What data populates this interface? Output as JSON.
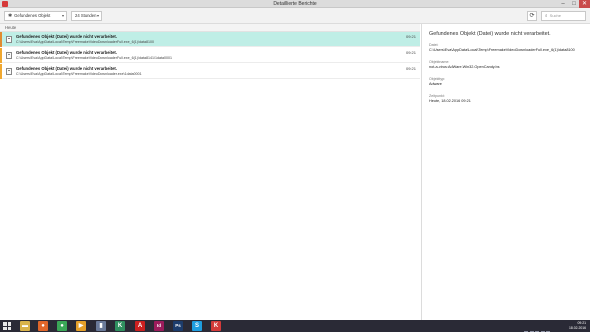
{
  "window": {
    "title": "Detaillierte Berichte"
  },
  "toolbar": {
    "filter_value": "Gefundenes Objekt",
    "time_value": "24 Stunden",
    "search_placeholder": "Suche"
  },
  "list": {
    "group_header": "Heute",
    "items": [
      {
        "title": "Gefundenes Objekt (Datei) wurde nicht verarbeitet.",
        "path": "C:\\Users\\Eva\\AppData\\Local\\Temp\\FreemakeVideoDownloaderFull.exe_6(1)\\data8100",
        "time": "09:21",
        "selected": true
      },
      {
        "title": "Gefundenes Objekt (Datei) wurde nicht verarbeitet.",
        "path": "C:\\Users\\Eva\\AppData\\Local\\Temp\\FreemakeVideoDownloaderFull.exe_6(1)\\data8141\\1data0001",
        "time": "09:21",
        "selected": false
      },
      {
        "title": "Gefundenes Objekt (Datei) wurde nicht verarbeitet.",
        "path": "C:\\Users\\Eva\\AppData\\Local\\Temp\\FreemakeVideoDownloader.exe\\1data0001",
        "time": "09:21",
        "selected": false
      }
    ]
  },
  "detail": {
    "title": "Gefundenes Objekt (Datei) wurde nicht verarbeitet.",
    "fields": [
      {
        "label": "Datei:",
        "value": "C:\\Users\\Eva\\AppData\\Local\\Temp\\FreemakeVideoDownloaderFull.exe_6(1)\\data8100"
      },
      {
        "label": "Objektname:",
        "value": "not-a-virus:AdWare.Win32.OpenCandy.bs"
      },
      {
        "label": "Objekttyp:",
        "value": "Adware"
      },
      {
        "label": "Zeitpunkt:",
        "value": "Heute, 18.02.2016 09:21"
      }
    ]
  },
  "taskbar": {
    "apps": [
      {
        "name": "file-explorer-icon",
        "color": "#d9b34a",
        "glyph": "▬"
      },
      {
        "name": "firefox-icon",
        "color": "#e0662a",
        "glyph": "●"
      },
      {
        "name": "chrome-icon",
        "color": "#3aa757",
        "glyph": "●"
      },
      {
        "name": "media-player-icon",
        "color": "#e5a02a",
        "glyph": "▶"
      },
      {
        "name": "document-icon",
        "color": "#6a7a9a",
        "glyph": "▮"
      },
      {
        "name": "security-app-icon",
        "color": "#2f8f5f",
        "glyph": "K"
      },
      {
        "name": "acrobat-icon",
        "color": "#cc2020",
        "glyph": "A"
      },
      {
        "name": "indesign-icon",
        "color": "#9c1c5c",
        "glyph": "Id"
      },
      {
        "name": "photoshop-icon",
        "color": "#1c3c6c",
        "glyph": "Ps"
      },
      {
        "name": "skype-icon",
        "color": "#1e9ee0",
        "glyph": "S"
      },
      {
        "name": "kaspersky-icon",
        "color": "#d43a3a",
        "glyph": "K"
      }
    ],
    "clock_time": "09:21",
    "clock_date": "18.02.2016"
  }
}
